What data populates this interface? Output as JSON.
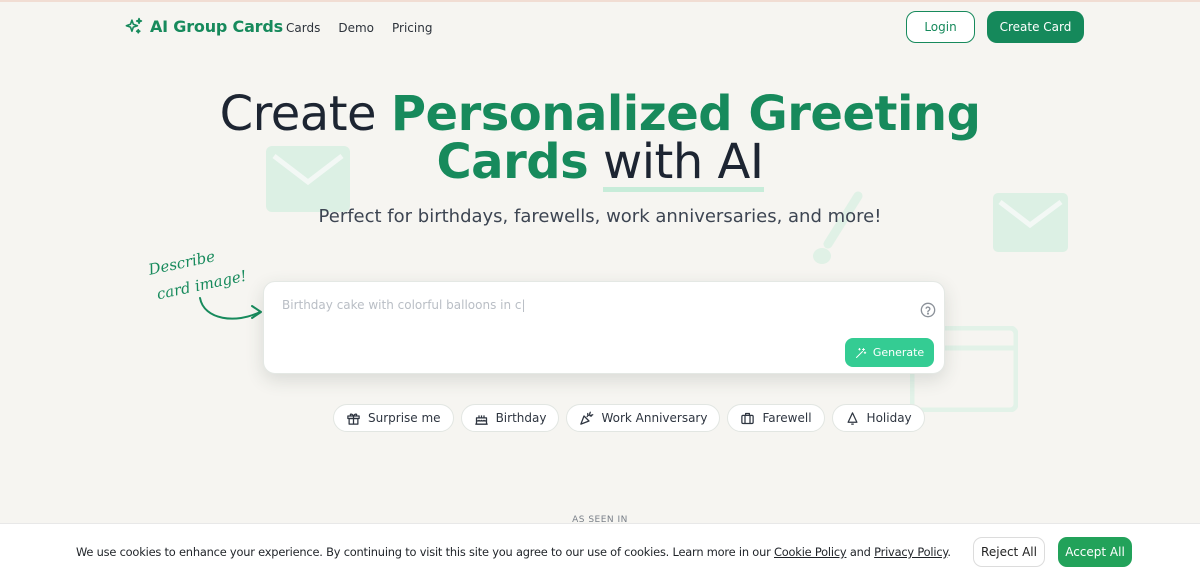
{
  "colors": {
    "brand": "#178a5c",
    "generate": "#34cc93",
    "accept": "#22a25a",
    "background": "#f6f5f1"
  },
  "nav": {
    "brand": "AI Group Cards",
    "links": [
      "Cards",
      "Demo",
      "Pricing"
    ],
    "login": "Login",
    "create": "Create Card"
  },
  "hero": {
    "title_prefix": "Create",
    "title_green_1": "Personalized Greeting",
    "title_green_2": "Cards",
    "title_suffix": "with AI",
    "subtitle": "Perfect for birthdays, farewells, work anniversaries, and more!",
    "annotation_line1": "Describe",
    "annotation_line2": "card image!"
  },
  "prompt": {
    "placeholder": "Birthday cake with colorful balloons in c|",
    "generate": "Generate"
  },
  "chips": [
    {
      "label": "Surprise me",
      "icon": "gift-icon"
    },
    {
      "label": "Birthday",
      "icon": "cake-icon"
    },
    {
      "label": "Work Anniversary",
      "icon": "party-popper-icon"
    },
    {
      "label": "Farewell",
      "icon": "briefcase-icon"
    },
    {
      "label": "Holiday",
      "icon": "bell-icon"
    }
  ],
  "as_seen_in": "AS SEEN IN",
  "cookie": {
    "text_before": "We use cookies to enhance your experience. By continuing to visit this site you agree to our use of cookies. Learn more in our ",
    "cookie_policy": "Cookie Policy",
    "and": " and ",
    "privacy_policy": "Privacy Policy",
    "period": ".",
    "reject": "Reject All",
    "accept": "Accept All"
  }
}
